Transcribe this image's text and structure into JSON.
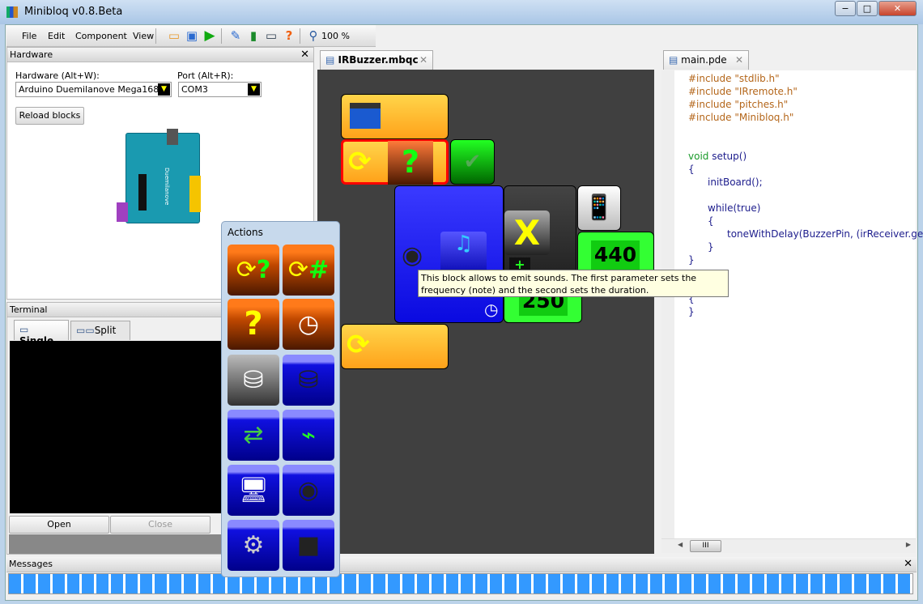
{
  "window": {
    "title": "Minibloq v0.8.Beta",
    "minimize": "−",
    "maximize": "□",
    "close": "✕"
  },
  "menu": [
    "File",
    "Edit",
    "Component",
    "View"
  ],
  "toolbar": {
    "icons": [
      "open-folder-icon",
      "save-icon",
      "run-icon",
      "edit-icon",
      "board-icon",
      "terminal-icon",
      "help-icon",
      "zoom-icon"
    ],
    "zoom": "100 %"
  },
  "hardware": {
    "title": "Hardware",
    "hardware_label": "Hardware (Alt+W):",
    "hardware_value": "Arduino Duemilanove Mega168",
    "port_label": "Port (Alt+R):",
    "port_value": "COM3",
    "reload": "Reload blocks",
    "board_label": "Duemilanove"
  },
  "terminal": {
    "title": "Terminal",
    "tabs": [
      "Single",
      "Split"
    ],
    "open": "Open",
    "close": "Close"
  },
  "editor": {
    "tab": "IRBuzzer.mbqc",
    "blocks": {
      "value1": "440",
      "value2": "250",
      "mult": "X",
      "plus": "+",
      "question": "?"
    }
  },
  "code": {
    "tab": "main.pde",
    "lines": [
      "#include \"stdlib.h\"",
      "#include \"IRremote.h\"",
      "#include \"pitches.h\"",
      "#include \"Minibloq.h\"",
      "void setup()",
      "{",
      "initBoard();",
      "while(true)",
      "{",
      "toneWithDelay(BuzzerPin, (irReceiver.getIR",
      "}",
      "}",
      "{",
      "}"
    ]
  },
  "tooltip": "This block allows to emit sounds. The first parameter sets the frequency (note) and the second sets the duration.",
  "actions": {
    "title": "Actions",
    "items": [
      "while-question",
      "while-number",
      "if",
      "delay",
      "variable-set",
      "variable",
      "serial",
      "oscilloscope",
      "communication",
      "sound",
      "settings",
      "servo"
    ]
  },
  "messages": {
    "title": "Messages",
    "progress": 100
  },
  "colors": {
    "canvas": "#404040",
    "progress": "#3399ff",
    "block_orange": "#ffa21a",
    "block_blue": "#1a1aff",
    "block_green": "#33ff33"
  }
}
